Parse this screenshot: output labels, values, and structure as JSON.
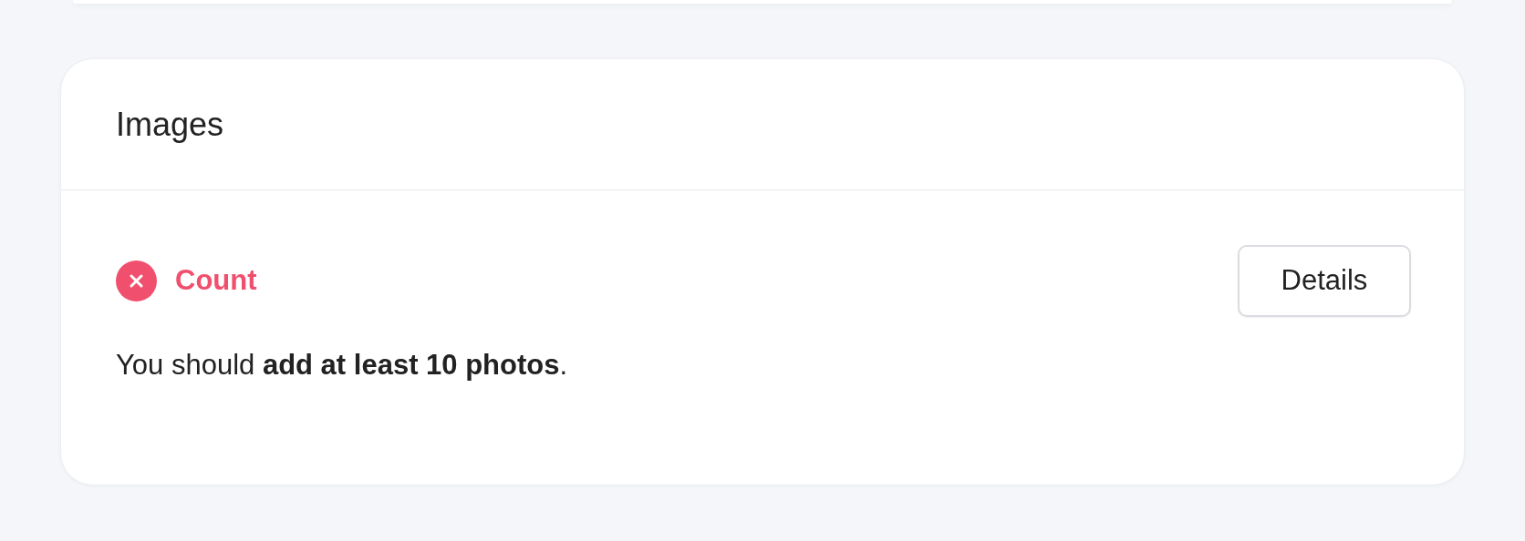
{
  "card": {
    "title": "Images"
  },
  "checks": [
    {
      "label": "Count",
      "passed": false,
      "button": "Details",
      "message": "You should **add at least 10 photos**."
    }
  ]
}
